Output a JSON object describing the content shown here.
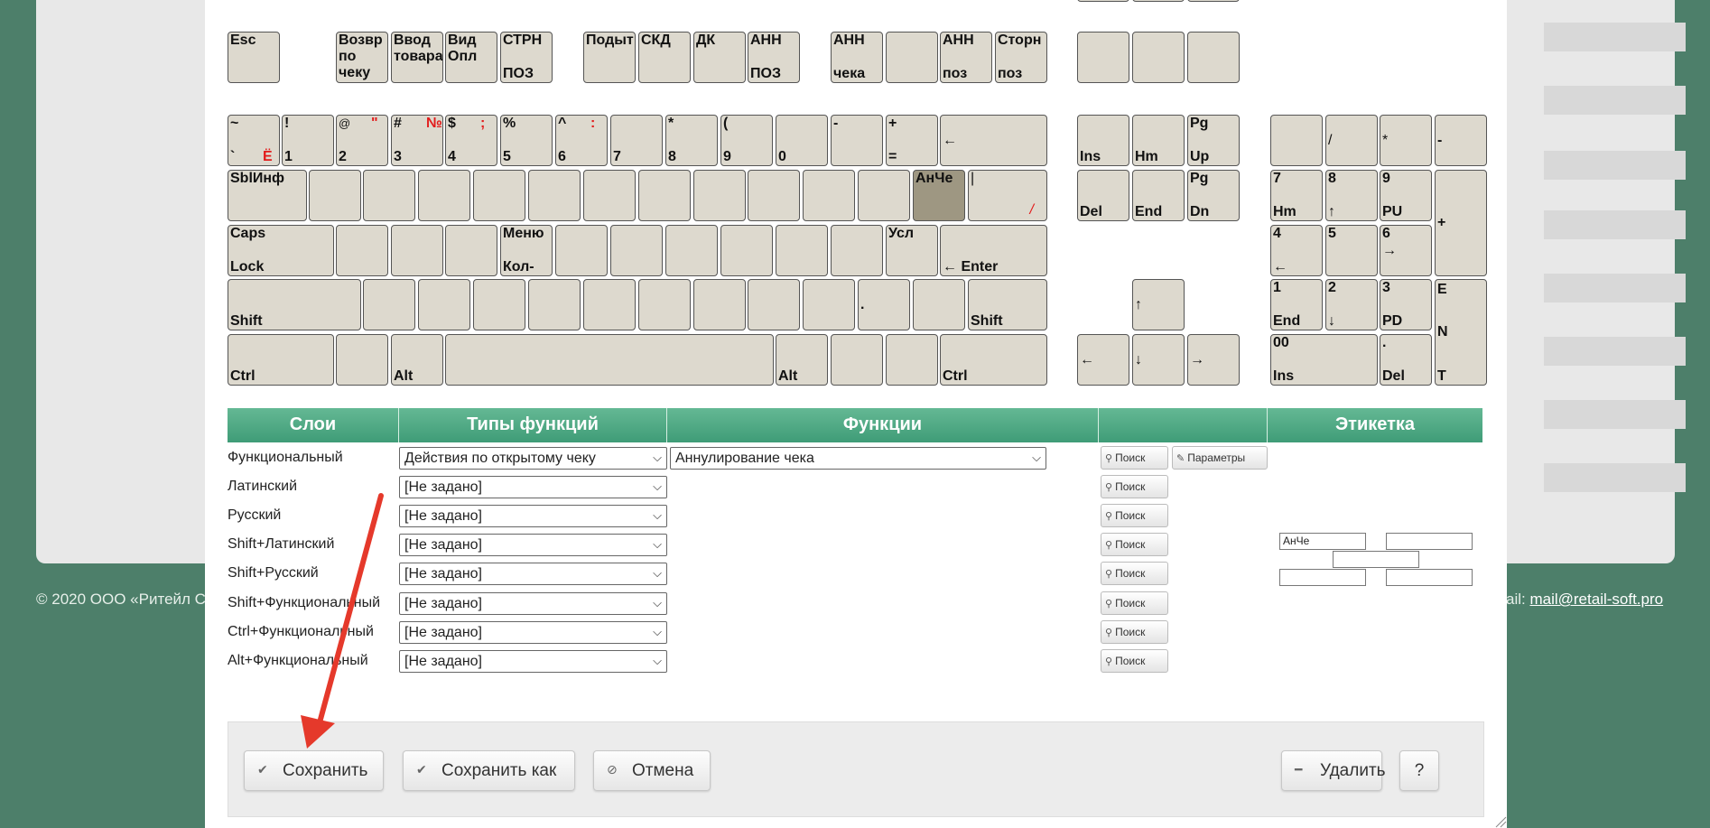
{
  "footer": {
    "copyright": "© 2020 ООО «Ритейл С",
    "email_label": "ail: ",
    "email": "mail@retail-soft.pro"
  },
  "keyboard": {
    "fkeys": {
      "esc": "Esc",
      "f1": "Возвр по чеку",
      "f2": "Ввод товара",
      "f3": "Вид Опл",
      "f4_top": "СТРН",
      "f4_bottom": "ПОЗ",
      "f5": "Подыт",
      "f6": "СКД",
      "f7": "ДК",
      "f8_top": "АНН",
      "f8_bottom": "ПОЗ",
      "f9_top": "АНН",
      "f9_bottom": "чека",
      "f10": "",
      "f11_top": "АНН",
      "f11_bottom": "поз",
      "f12_top": "Сторн",
      "f12_bottom": "поз"
    },
    "number_row": [
      {
        "top": "~",
        "bottom": "`",
        "red": "Ё"
      },
      {
        "top": "!",
        "bottom": "1",
        "red": ""
      },
      {
        "top": "@",
        "bottom": "2",
        "red": "\""
      },
      {
        "top": "#",
        "bottom": "3",
        "red": "№"
      },
      {
        "top": "$",
        "bottom": "4",
        "red": ";"
      },
      {
        "top": "%",
        "bottom": "5",
        "red": ""
      },
      {
        "top": "^",
        "bottom": "6",
        "red": ":"
      },
      {
        "top": "",
        "bottom": "7",
        "red": ""
      },
      {
        "top": "*",
        "bottom": "8",
        "red": ""
      },
      {
        "top": "(",
        "bottom": "9",
        "red": ""
      },
      {
        "top": "",
        "bottom": "0",
        "red": ""
      },
      {
        "top": "-",
        "bottom": "",
        "red": ""
      },
      {
        "top": "+",
        "bottom": "=",
        "red": ""
      }
    ],
    "backspace": "←",
    "tab": "SblИнф",
    "selected_key": "АнЧе",
    "backslash_top": "|",
    "backslash_red": "/",
    "caps_top": "Caps",
    "caps_bottom": "Lock",
    "menu_top": "Меню",
    "menu_bottom": "Кол-",
    "usl": "Усл",
    "enter": "← Enter",
    "shift": "Shift",
    "period": ".",
    "ctrl": "Ctrl",
    "alt": "Alt",
    "nav": {
      "ins": "Ins",
      "home": "Hm",
      "pgup_top": "Pg",
      "pgup_bottom": "Up",
      "del": "Del",
      "end": "End",
      "pgdn_top": "Pg",
      "pgdn_bottom": "Dn",
      "up": "↑",
      "left": "←",
      "down": "↓",
      "right": "→"
    },
    "numpad": {
      "slash": "/",
      "star": "*",
      "minus": "-",
      "plus": "+",
      "n7_top": "7",
      "n7_bottom": "Hm",
      "n8_top": "8",
      "n8_bottom": "↑",
      "n9_top": "9",
      "n9_bottom": "PU",
      "n4_top": "4",
      "n4_bottom": "←",
      "n5": "5",
      "n6_top": "6",
      "n6_bottom": "→",
      "n1_top": "1",
      "n1_bottom": "End",
      "n2_top": "2",
      "n2_bottom": "↓",
      "n3_top": "3",
      "n3_bottom": "PD",
      "n0_top": "00",
      "n0_bottom": "Ins",
      "ndot_top": ".",
      "ndot_bottom": "Del",
      "enter_1": "E",
      "enter_2": "N",
      "enter_3": "T"
    }
  },
  "grid": {
    "headers": {
      "layers": "Слои",
      "function_types": "Типы функций",
      "functions": "Функции",
      "actions": "",
      "label": "Этикетка"
    },
    "rows": [
      {
        "layer": "Функциональный",
        "type": "Действия по открытому чеку",
        "function": "Аннулирование чека"
      },
      {
        "layer": "Латинский",
        "type": "[Не задано]"
      },
      {
        "layer": "Русский",
        "type": "[Не задано]"
      },
      {
        "layer": "Shift+Латинский",
        "type": "[Не задано]"
      },
      {
        "layer": "Shift+Русский",
        "type": "[Не задано]"
      },
      {
        "layer": "Shift+Функциональный",
        "type": "[Не задано]"
      },
      {
        "layer": "Ctrl+Функциональный",
        "type": "[Не задано]"
      },
      {
        "layer": "Alt+Функциональный",
        "type": "[Не задано]"
      }
    ],
    "search_label": "Поиск",
    "params_label": "Параметры",
    "label_fields": [
      "АнЧе",
      "",
      "",
      "",
      ""
    ]
  },
  "actions": {
    "save": "Сохранить",
    "save_as": "Сохранить как",
    "cancel": "Отмена",
    "delete": "Удалить",
    "help": "?"
  },
  "colors": {
    "accent": "#4aa882",
    "background": "#4d7f6a",
    "key": "#ddd9ce",
    "selected_key": "#9e9782",
    "arrow": "#e5392b"
  }
}
